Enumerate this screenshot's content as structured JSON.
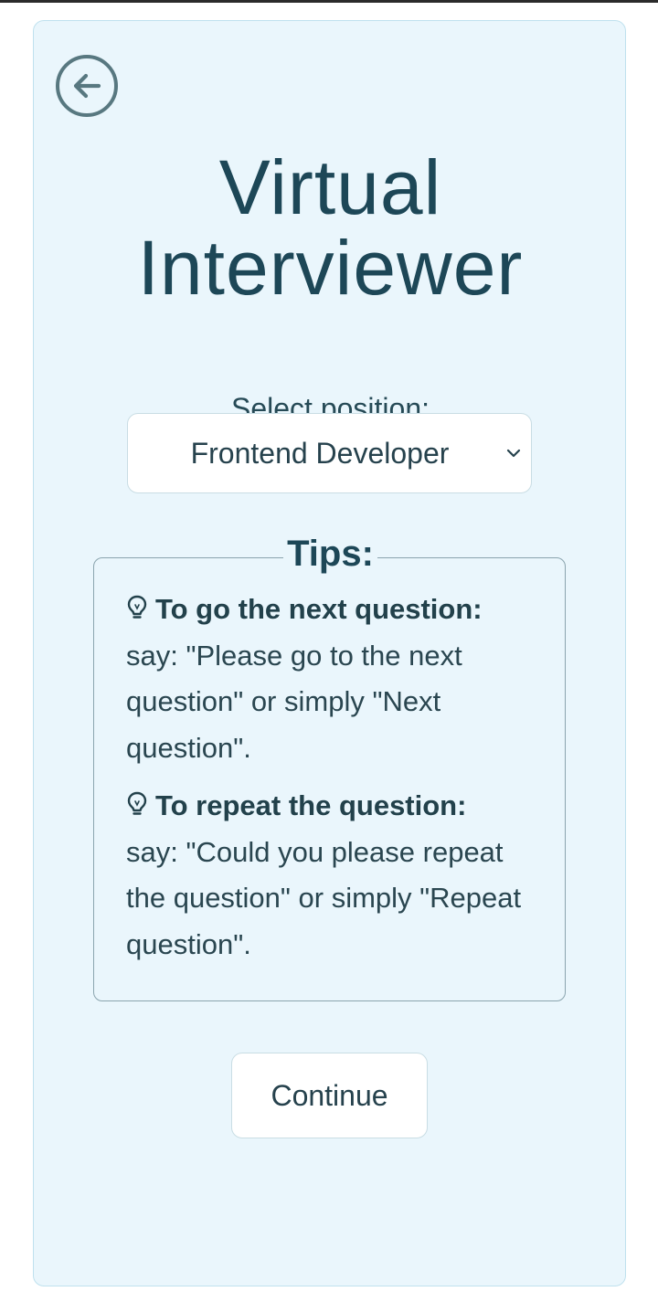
{
  "app": {
    "title_line1": "Virtual",
    "title_line2": "Interviewer",
    "accent_color": "#1d4757",
    "card_background": "#eaf6fc"
  },
  "back_button": {
    "icon": "arrow-left-circle-icon"
  },
  "position_select": {
    "label": "Select position:",
    "selected": "Frontend Developer",
    "icon": "chevron-down-icon"
  },
  "tips": {
    "heading": "Tips:",
    "items": [
      {
        "icon": "lightbulb-icon",
        "title": "To go the next question:",
        "body": "say: \"Please go to the next question\" or simply \"Next question\"."
      },
      {
        "icon": "lightbulb-icon",
        "title": "To repeat the question:",
        "body": "say: \"Could you please repeat the question\" or simply \"Repeat question\"."
      }
    ]
  },
  "continue_button": {
    "label": "Continue"
  }
}
